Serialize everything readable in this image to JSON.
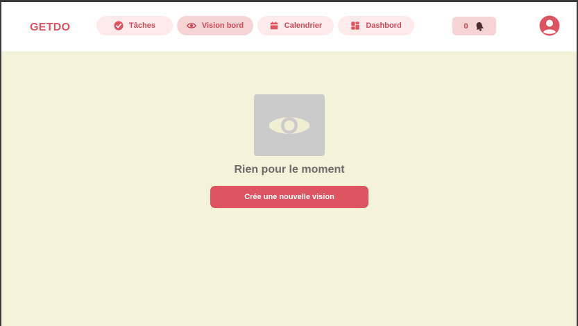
{
  "app": {
    "logo": "GETDO"
  },
  "nav": {
    "items": [
      {
        "label": "Tâches",
        "icon": "check-circle-icon"
      },
      {
        "label": "Vision bord",
        "icon": "eye-icon",
        "active": true
      },
      {
        "label": "Calendrier",
        "icon": "calendar-icon"
      },
      {
        "label": "Dashbord",
        "icon": "dashboard-icon"
      }
    ]
  },
  "notifications": {
    "count": "0",
    "icon": "bell-icon"
  },
  "user": {
    "icon": "user-avatar-icon"
  },
  "empty_state": {
    "image_icon": "eye-icon",
    "message": "Rien pour le moment",
    "button_label": "Crée une nouvelle vision"
  },
  "colors": {
    "accent": "#dc5561",
    "background": "#f4f3da",
    "nav_pill": "#fdebeb",
    "nav_pill_active": "#f6d3d4"
  }
}
